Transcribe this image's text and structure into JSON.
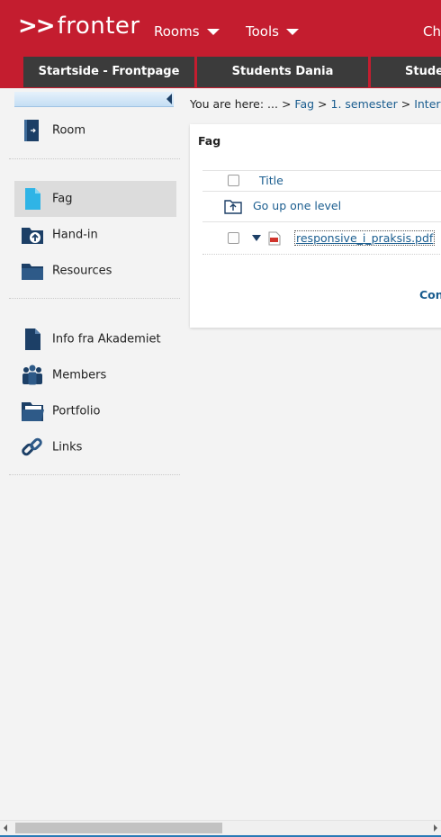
{
  "header": {
    "logo_arrows": ">>",
    "logo_text": "fronter",
    "menu": [
      "Rooms",
      "Tools",
      "Ch"
    ]
  },
  "tabs": [
    "Startside - Frontpage",
    "Students Dania",
    "Studen"
  ],
  "sidebar": {
    "items": [
      {
        "label": "Room",
        "icon": "door-icon"
      },
      {
        "label": "Fag",
        "icon": "document-icon",
        "active": true
      },
      {
        "label": "Hand-in",
        "icon": "upload-folder-icon"
      },
      {
        "label": "Resources",
        "icon": "folder-icon"
      },
      {
        "label": "Info fra Akademiet",
        "icon": "document-icon"
      },
      {
        "label": "Members",
        "icon": "members-icon"
      },
      {
        "label": "Portfolio",
        "icon": "portfolio-icon"
      },
      {
        "label": "Links",
        "icon": "chain-link-icon"
      }
    ]
  },
  "breadcrumb": {
    "prefix": "You are here: ... >",
    "items": [
      "Fag",
      "1. semester",
      "Intera"
    ],
    "separator": ">"
  },
  "panel": {
    "title": "Fag",
    "column_title": "Title",
    "up_label": "Go up one level",
    "file_name": "responsive_i_praksis.pdf",
    "continue_label": "Con"
  },
  "colors": {
    "brand_red": "#c41d2f",
    "tab_dark": "#3b3b3b",
    "link_blue": "#1a5d8f",
    "icon_navy": "#1c3f66"
  }
}
